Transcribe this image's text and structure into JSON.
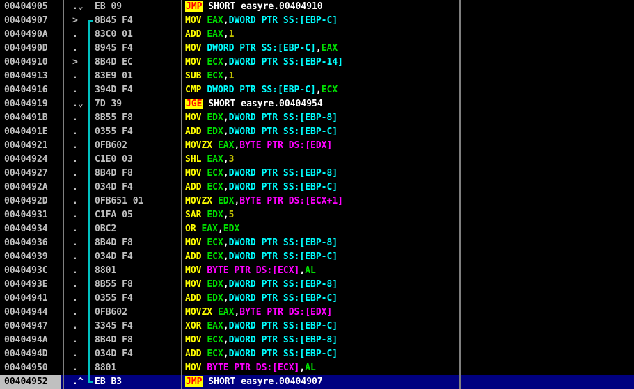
{
  "colors": {
    "background": "#000000",
    "address": "#c0c0c0",
    "mnemonic": "#ffff00",
    "register": "#00e000",
    "memory_operand": "#00ffff",
    "byte_operand": "#ff00ff",
    "immediate": "#c0c000",
    "jump_highlight_bg": "#ffff00",
    "jump_highlight_fg": "#ff0000",
    "selected_row_bg": "#000080",
    "jump_arrow": "#00c0c0"
  },
  "rows": [
    {
      "addr": "00404905",
      "mark": ".⌄",
      "hex": "EB 09",
      "tokens": [
        {
          "t": "JMP",
          "c": "t-jmp"
        },
        {
          "t": " SHORT easyre.00404910",
          "c": "t-text"
        }
      ]
    },
    {
      "addr": "00404907",
      "mark": ">",
      "hex": "8B45 F4",
      "tokens": [
        {
          "t": "MOV",
          "c": "t-mn"
        },
        {
          "t": " ",
          "c": "t-text"
        },
        {
          "t": "EAX",
          "c": "t-reg"
        },
        {
          "t": ",",
          "c": "t-text"
        },
        {
          "t": "DWORD PTR SS:[EBP-C]",
          "c": "t-mem"
        }
      ]
    },
    {
      "addr": "0040490A",
      "mark": ".",
      "hex": "83C0 01",
      "tokens": [
        {
          "t": "ADD",
          "c": "t-mn"
        },
        {
          "t": " ",
          "c": "t-text"
        },
        {
          "t": "EAX",
          "c": "t-reg"
        },
        {
          "t": ",",
          "c": "t-text"
        },
        {
          "t": "1",
          "c": "t-imm"
        }
      ]
    },
    {
      "addr": "0040490D",
      "mark": ".",
      "hex": "8945 F4",
      "tokens": [
        {
          "t": "MOV",
          "c": "t-mn"
        },
        {
          "t": " ",
          "c": "t-text"
        },
        {
          "t": "DWORD PTR SS:[EBP-C]",
          "c": "t-mem"
        },
        {
          "t": ",",
          "c": "t-text"
        },
        {
          "t": "EAX",
          "c": "t-reg"
        }
      ]
    },
    {
      "addr": "00404910",
      "mark": ">",
      "hex": "8B4D EC",
      "tokens": [
        {
          "t": "MOV",
          "c": "t-mn"
        },
        {
          "t": " ",
          "c": "t-text"
        },
        {
          "t": "ECX",
          "c": "t-reg"
        },
        {
          "t": ",",
          "c": "t-text"
        },
        {
          "t": "DWORD PTR SS:[EBP-14]",
          "c": "t-mem"
        }
      ]
    },
    {
      "addr": "00404913",
      "mark": ".",
      "hex": "83E9 01",
      "tokens": [
        {
          "t": "SUB",
          "c": "t-mn"
        },
        {
          "t": " ",
          "c": "t-text"
        },
        {
          "t": "ECX",
          "c": "t-reg"
        },
        {
          "t": ",",
          "c": "t-text"
        },
        {
          "t": "1",
          "c": "t-imm"
        }
      ]
    },
    {
      "addr": "00404916",
      "mark": ".",
      "hex": "394D F4",
      "tokens": [
        {
          "t": "CMP",
          "c": "t-mn"
        },
        {
          "t": " ",
          "c": "t-text"
        },
        {
          "t": "DWORD PTR SS:[EBP-C]",
          "c": "t-mem"
        },
        {
          "t": ",",
          "c": "t-text"
        },
        {
          "t": "ECX",
          "c": "t-reg"
        }
      ]
    },
    {
      "addr": "00404919",
      "mark": ".⌄",
      "hex": "7D 39",
      "tokens": [
        {
          "t": "JGE",
          "c": "t-jmp"
        },
        {
          "t": " SHORT easyre.00404954",
          "c": "t-text"
        }
      ]
    },
    {
      "addr": "0040491B",
      "mark": ".",
      "hex": "8B55 F8",
      "tokens": [
        {
          "t": "MOV",
          "c": "t-mn"
        },
        {
          "t": " ",
          "c": "t-text"
        },
        {
          "t": "EDX",
          "c": "t-reg"
        },
        {
          "t": ",",
          "c": "t-text"
        },
        {
          "t": "DWORD PTR SS:[EBP-8]",
          "c": "t-mem"
        }
      ]
    },
    {
      "addr": "0040491E",
      "mark": ".",
      "hex": "0355 F4",
      "tokens": [
        {
          "t": "ADD",
          "c": "t-mn"
        },
        {
          "t": " ",
          "c": "t-text"
        },
        {
          "t": "EDX",
          "c": "t-reg"
        },
        {
          "t": ",",
          "c": "t-text"
        },
        {
          "t": "DWORD PTR SS:[EBP-C]",
          "c": "t-mem"
        }
      ]
    },
    {
      "addr": "00404921",
      "mark": ".",
      "hex": "0FB602",
      "tokens": [
        {
          "t": "MOVZX",
          "c": "t-mn"
        },
        {
          "t": " ",
          "c": "t-text"
        },
        {
          "t": "EAX",
          "c": "t-reg"
        },
        {
          "t": ",",
          "c": "t-text"
        },
        {
          "t": "BYTE PTR DS:[EDX]",
          "c": "t-byte"
        }
      ]
    },
    {
      "addr": "00404924",
      "mark": ".",
      "hex": "C1E0 03",
      "tokens": [
        {
          "t": "SHL",
          "c": "t-mn"
        },
        {
          "t": " ",
          "c": "t-text"
        },
        {
          "t": "EAX",
          "c": "t-reg"
        },
        {
          "t": ",",
          "c": "t-text"
        },
        {
          "t": "3",
          "c": "t-imm"
        }
      ]
    },
    {
      "addr": "00404927",
      "mark": ".",
      "hex": "8B4D F8",
      "tokens": [
        {
          "t": "MOV",
          "c": "t-mn"
        },
        {
          "t": " ",
          "c": "t-text"
        },
        {
          "t": "ECX",
          "c": "t-reg"
        },
        {
          "t": ",",
          "c": "t-text"
        },
        {
          "t": "DWORD PTR SS:[EBP-8]",
          "c": "t-mem"
        }
      ]
    },
    {
      "addr": "0040492A",
      "mark": ".",
      "hex": "034D F4",
      "tokens": [
        {
          "t": "ADD",
          "c": "t-mn"
        },
        {
          "t": " ",
          "c": "t-text"
        },
        {
          "t": "ECX",
          "c": "t-reg"
        },
        {
          "t": ",",
          "c": "t-text"
        },
        {
          "t": "DWORD PTR SS:[EBP-C]",
          "c": "t-mem"
        }
      ]
    },
    {
      "addr": "0040492D",
      "mark": ".",
      "hex": "0FB651 01",
      "tokens": [
        {
          "t": "MOVZX",
          "c": "t-mn"
        },
        {
          "t": " ",
          "c": "t-text"
        },
        {
          "t": "EDX",
          "c": "t-reg"
        },
        {
          "t": ",",
          "c": "t-text"
        },
        {
          "t": "BYTE PTR DS:[ECX+1]",
          "c": "t-byte"
        }
      ]
    },
    {
      "addr": "00404931",
      "mark": ".",
      "hex": "C1FA 05",
      "tokens": [
        {
          "t": "SAR",
          "c": "t-mn"
        },
        {
          "t": " ",
          "c": "t-text"
        },
        {
          "t": "EDX",
          "c": "t-reg"
        },
        {
          "t": ",",
          "c": "t-text"
        },
        {
          "t": "5",
          "c": "t-imm"
        }
      ]
    },
    {
      "addr": "00404934",
      "mark": ".",
      "hex": "0BC2",
      "tokens": [
        {
          "t": "OR",
          "c": "t-mn"
        },
        {
          "t": " ",
          "c": "t-text"
        },
        {
          "t": "EAX",
          "c": "t-reg"
        },
        {
          "t": ",",
          "c": "t-text"
        },
        {
          "t": "EDX",
          "c": "t-reg"
        }
      ]
    },
    {
      "addr": "00404936",
      "mark": ".",
      "hex": "8B4D F8",
      "tokens": [
        {
          "t": "MOV",
          "c": "t-mn"
        },
        {
          "t": " ",
          "c": "t-text"
        },
        {
          "t": "ECX",
          "c": "t-reg"
        },
        {
          "t": ",",
          "c": "t-text"
        },
        {
          "t": "DWORD PTR SS:[EBP-8]",
          "c": "t-mem"
        }
      ]
    },
    {
      "addr": "00404939",
      "mark": ".",
      "hex": "034D F4",
      "tokens": [
        {
          "t": "ADD",
          "c": "t-mn"
        },
        {
          "t": " ",
          "c": "t-text"
        },
        {
          "t": "ECX",
          "c": "t-reg"
        },
        {
          "t": ",",
          "c": "t-text"
        },
        {
          "t": "DWORD PTR SS:[EBP-C]",
          "c": "t-mem"
        }
      ]
    },
    {
      "addr": "0040493C",
      "mark": ".",
      "hex": "8801",
      "tokens": [
        {
          "t": "MOV",
          "c": "t-mn"
        },
        {
          "t": " ",
          "c": "t-text"
        },
        {
          "t": "BYTE PTR DS:[ECX]",
          "c": "t-byte"
        },
        {
          "t": ",",
          "c": "t-text"
        },
        {
          "t": "AL",
          "c": "t-reg"
        }
      ]
    },
    {
      "addr": "0040493E",
      "mark": ".",
      "hex": "8B55 F8",
      "tokens": [
        {
          "t": "MOV",
          "c": "t-mn"
        },
        {
          "t": " ",
          "c": "t-text"
        },
        {
          "t": "EDX",
          "c": "t-reg"
        },
        {
          "t": ",",
          "c": "t-text"
        },
        {
          "t": "DWORD PTR SS:[EBP-8]",
          "c": "t-mem"
        }
      ]
    },
    {
      "addr": "00404941",
      "mark": ".",
      "hex": "0355 F4",
      "tokens": [
        {
          "t": "ADD",
          "c": "t-mn"
        },
        {
          "t": " ",
          "c": "t-text"
        },
        {
          "t": "EDX",
          "c": "t-reg"
        },
        {
          "t": ",",
          "c": "t-text"
        },
        {
          "t": "DWORD PTR SS:[EBP-C]",
          "c": "t-mem"
        }
      ]
    },
    {
      "addr": "00404944",
      "mark": ".",
      "hex": "0FB602",
      "tokens": [
        {
          "t": "MOVZX",
          "c": "t-mn"
        },
        {
          "t": " ",
          "c": "t-text"
        },
        {
          "t": "EAX",
          "c": "t-reg"
        },
        {
          "t": ",",
          "c": "t-text"
        },
        {
          "t": "BYTE PTR DS:[EDX]",
          "c": "t-byte"
        }
      ]
    },
    {
      "addr": "00404947",
      "mark": ".",
      "hex": "3345 F4",
      "tokens": [
        {
          "t": "XOR",
          "c": "t-mn"
        },
        {
          "t": " ",
          "c": "t-text"
        },
        {
          "t": "EAX",
          "c": "t-reg"
        },
        {
          "t": ",",
          "c": "t-text"
        },
        {
          "t": "DWORD PTR SS:[EBP-C]",
          "c": "t-mem"
        }
      ]
    },
    {
      "addr": "0040494A",
      "mark": ".",
      "hex": "8B4D F8",
      "tokens": [
        {
          "t": "MOV",
          "c": "t-mn"
        },
        {
          "t": " ",
          "c": "t-text"
        },
        {
          "t": "ECX",
          "c": "t-reg"
        },
        {
          "t": ",",
          "c": "t-text"
        },
        {
          "t": "DWORD PTR SS:[EBP-8]",
          "c": "t-mem"
        }
      ]
    },
    {
      "addr": "0040494D",
      "mark": ".",
      "hex": "034D F4",
      "tokens": [
        {
          "t": "ADD",
          "c": "t-mn"
        },
        {
          "t": " ",
          "c": "t-text"
        },
        {
          "t": "ECX",
          "c": "t-reg"
        },
        {
          "t": ",",
          "c": "t-text"
        },
        {
          "t": "DWORD PTR SS:[EBP-C]",
          "c": "t-mem"
        }
      ]
    },
    {
      "addr": "00404950",
      "mark": ".",
      "hex": "8801",
      "tokens": [
        {
          "t": "MOV",
          "c": "t-mn"
        },
        {
          "t": " ",
          "c": "t-text"
        },
        {
          "t": "BYTE PTR DS:[ECX]",
          "c": "t-byte"
        },
        {
          "t": ",",
          "c": "t-text"
        },
        {
          "t": "AL",
          "c": "t-reg"
        }
      ]
    },
    {
      "addr": "00404952",
      "mark": ".^",
      "hex": "EB B3",
      "selected": true,
      "tokens": [
        {
          "t": "JMP",
          "c": "t-jmp"
        },
        {
          "t": " SHORT easyre.00404907",
          "c": "t-text"
        }
      ]
    }
  ]
}
